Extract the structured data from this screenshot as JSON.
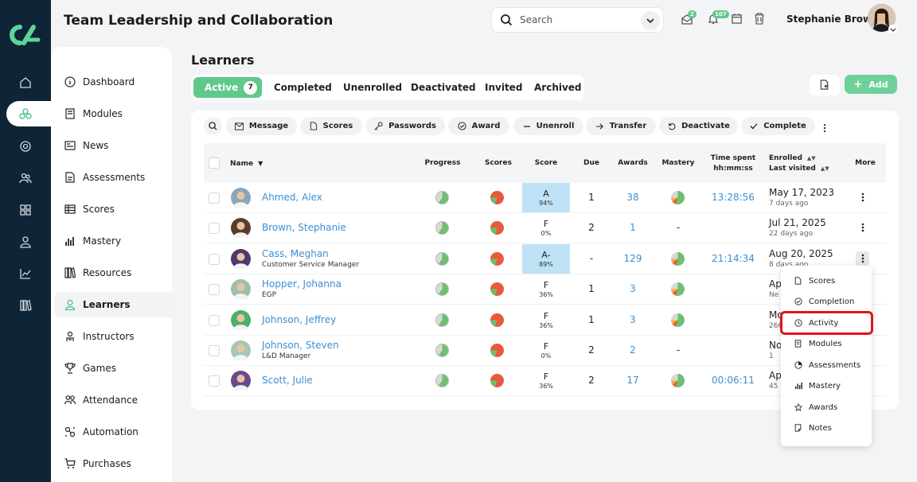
{
  "header": {
    "title": "Team Leadership and Collaboration",
    "search_placeholder": "Search",
    "messages_badge": "2",
    "notifications_badge": "107",
    "user_name": "Stephanie Brown"
  },
  "sidebar": {
    "items": [
      {
        "label": "Dashboard",
        "icon": "info-icon"
      },
      {
        "label": "Modules",
        "icon": "book-icon"
      },
      {
        "label": "News",
        "icon": "newspaper-icon"
      },
      {
        "label": "Assessments",
        "icon": "document-icon"
      },
      {
        "label": "Scores",
        "icon": "table-icon"
      },
      {
        "label": "Mastery",
        "icon": "bar-chart-icon"
      },
      {
        "label": "Resources",
        "icon": "library-icon"
      },
      {
        "label": "Learners",
        "icon": "user-icon"
      },
      {
        "label": "Instructors",
        "icon": "instructor-icon"
      },
      {
        "label": "Games",
        "icon": "trophy-icon"
      },
      {
        "label": "Attendance",
        "icon": "group-icon"
      },
      {
        "label": "Automation",
        "icon": "automation-icon"
      },
      {
        "label": "Purchases",
        "icon": "cart-icon"
      }
    ],
    "active": "Learners"
  },
  "page": {
    "title": "Learners",
    "tabs": [
      {
        "label": "Active",
        "count": "7"
      },
      {
        "label": "Completed"
      },
      {
        "label": "Unenrolled"
      },
      {
        "label": "Deactivated"
      },
      {
        "label": "Invited"
      },
      {
        "label": "Archived"
      }
    ],
    "add_label": "Add"
  },
  "toolbar": {
    "buttons": [
      "Message",
      "Scores",
      "Passwords",
      "Award",
      "Unenroll",
      "Transfer",
      "Deactivate",
      "Complete"
    ]
  },
  "table": {
    "headers": {
      "name": "Name",
      "progress": "Progress",
      "scores": "Scores",
      "score": "Score",
      "due": "Due",
      "awards": "Awards",
      "mastery": "Mastery",
      "time_spent_1": "Time spent",
      "time_spent_2": "hh:mm:ss",
      "enrolled": "Enrolled",
      "last_visited": "Last visited",
      "more": "More"
    },
    "rows": [
      {
        "name": "Ahmed, Alex",
        "subtitle": "",
        "grade": "A",
        "pct": "94%",
        "due": "1",
        "awards": "38",
        "mastery": "pie",
        "time": "13:28:56",
        "date": "May 17, 2023",
        "last": "7 days ago",
        "highlight": true,
        "avatar_color": "#8aa6b8"
      },
      {
        "name": "Brown, Stephanie",
        "subtitle": "",
        "grade": "F",
        "pct": "0%",
        "due": "2",
        "awards": "1",
        "mastery": "-",
        "time": "",
        "date": "Jul 21, 2025",
        "last": "22 days ago",
        "highlight": false,
        "avatar_color": "#5b3b2b"
      },
      {
        "name": "Cass, Meghan",
        "subtitle": "Customer Service Manager",
        "grade": "A-",
        "pct": "89%",
        "due": "-",
        "awards": "129",
        "mastery": "pie",
        "time": "21:14:34",
        "date": "Aug 20, 2025",
        "last": "8 days ago",
        "highlight": true,
        "avatar_color": "#4b3a6a"
      },
      {
        "name": "Hopper, Johanna",
        "subtitle": "EGP",
        "grade": "F",
        "pct": "36%",
        "due": "1",
        "awards": "3",
        "mastery": "pie",
        "time": "",
        "date": "Ap",
        "last": "Ne",
        "highlight": false,
        "avatar_color": "#9fbfae"
      },
      {
        "name": "Johnson, Jeffrey",
        "subtitle": "",
        "grade": "F",
        "pct": "36%",
        "due": "1",
        "awards": "3",
        "mastery": "pie",
        "time": "",
        "date": "Mo",
        "last": "266",
        "highlight": false,
        "avatar_color": "#4caf6a"
      },
      {
        "name": "Johnson, Steven",
        "subtitle": "L&D Manager",
        "grade": "F",
        "pct": "0%",
        "due": "2",
        "awards": "2",
        "mastery": "-",
        "time": "",
        "date": "No",
        "last": "1",
        "highlight": false,
        "avatar_color": "#a7c6b5"
      },
      {
        "name": "Scott, Julie",
        "subtitle": "",
        "grade": "F",
        "pct": "36%",
        "due": "2",
        "awards": "17",
        "mastery": "pie",
        "time": "00:06:11",
        "date": "Ap",
        "last": "45",
        "highlight": false,
        "avatar_color": "#6a4a8a"
      }
    ]
  },
  "context_menu": {
    "items": [
      "Scores",
      "Completion",
      "Activity",
      "Modules",
      "Assessments",
      "Mastery",
      "Awards",
      "Notes"
    ],
    "highlighted": "Activity"
  },
  "colors": {
    "accent": "#5fc98b",
    "link": "#3d8fd1",
    "rail": "#0f2436",
    "score_highlight": "#bfe2f6",
    "annotation": "#e0141b"
  }
}
